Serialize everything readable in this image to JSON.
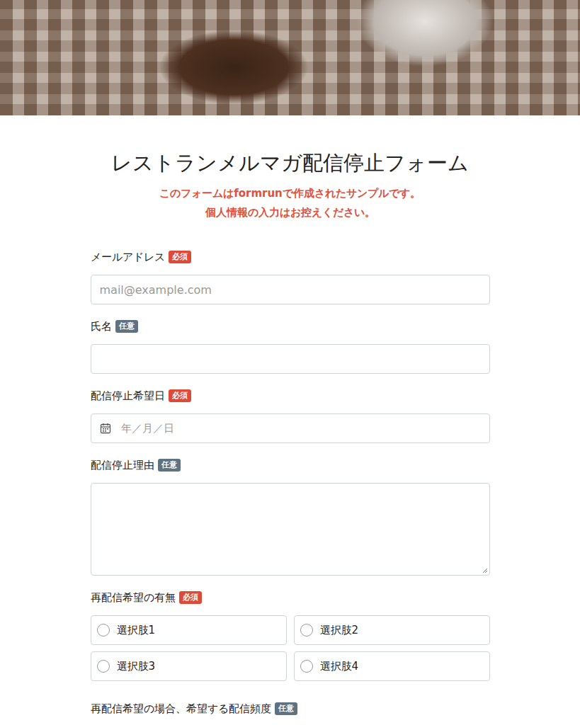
{
  "form": {
    "title": "レストランメルマガ配信停止フォーム",
    "notice": [
      "このフォームはformrunで作成されたサンプルです。",
      "個人情報の入力はお控えください。"
    ]
  },
  "fields": [
    {
      "label": "メールアドレス",
      "badge": "必須",
      "required": true,
      "kind": "text",
      "placeholder": "mail@example.com"
    },
    {
      "label": "氏名",
      "badge": "任意",
      "required": false,
      "kind": "text",
      "placeholder": ""
    },
    {
      "label": "配信停止希望日",
      "badge": "必須",
      "required": true,
      "kind": "date",
      "placeholder": "年／月／日"
    },
    {
      "label": "配信停止理由",
      "badge": "任意",
      "required": false,
      "kind": "textarea",
      "placeholder": ""
    },
    {
      "label": "再配信希望の有無",
      "badge": "必須",
      "required": true,
      "kind": "radio",
      "options": [
        {
          "label": "選択肢1",
          "selected": false
        },
        {
          "label": "選択肢2",
          "selected": false
        },
        {
          "label": "選択肢3",
          "selected": false
        },
        {
          "label": "選択肢4",
          "selected": false
        }
      ]
    },
    {
      "label": "再配信希望の場合、希望する配信頻度",
      "badge": "任意",
      "required": false,
      "kind": "text",
      "placeholder": ""
    }
  ]
}
